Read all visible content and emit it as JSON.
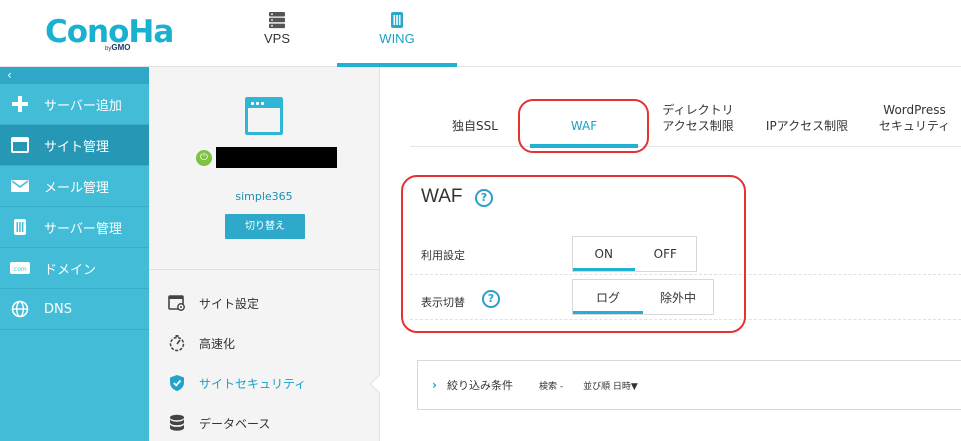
{
  "header": {
    "logo_text": "ConoHa",
    "logo_sub_by": "by",
    "logo_sub_brand": "GMO",
    "tabs": [
      {
        "label": "VPS",
        "active": false,
        "icon": "server-rack-icon"
      },
      {
        "label": "WING",
        "active": true,
        "icon": "wing-server-icon"
      }
    ]
  },
  "leftnav": {
    "collapse_glyph": "‹",
    "items": [
      {
        "label": "サーバー追加",
        "icon": "plus-icon",
        "active": false
      },
      {
        "label": "サイト管理",
        "icon": "window-icon",
        "active": true
      },
      {
        "label": "メール管理",
        "icon": "mail-icon",
        "active": false
      },
      {
        "label": "サーバー管理",
        "icon": "server-icon",
        "active": false
      },
      {
        "label": "ドメイン",
        "icon": "domain-icon",
        "active": false
      },
      {
        "label": "DNS",
        "icon": "globe-icon",
        "active": false
      }
    ]
  },
  "server": {
    "name": "simple365",
    "switch_label": "切り替え",
    "status": "on",
    "sub_items": [
      {
        "label": "サイト設定",
        "icon": "site-settings-icon",
        "active": false
      },
      {
        "label": "高速化",
        "icon": "speed-icon",
        "active": false
      },
      {
        "label": "サイトセキュリティ",
        "icon": "shield-icon",
        "active": true
      },
      {
        "label": "データベース",
        "icon": "database-icon",
        "active": false
      }
    ]
  },
  "security_tabs": [
    {
      "label": "独自SSL",
      "active": false
    },
    {
      "label": "WAF",
      "active": true
    },
    {
      "label": "ディレクトリ\nアクセス制限",
      "active": false
    },
    {
      "label": "IPアクセス制限",
      "active": false
    },
    {
      "label": "WordPress\nセキュリティ",
      "active": false
    }
  ],
  "waf": {
    "title": "WAF",
    "help_glyph": "?",
    "usage_label": "利用設定",
    "usage_options": [
      "ON",
      "OFF"
    ],
    "usage_selected": "ON",
    "display_label": "表示切替",
    "display_options": [
      "ログ",
      "除外中"
    ],
    "display_selected": "ログ"
  },
  "filter": {
    "title": "絞り込み条件",
    "search_text": "検索 -",
    "sort_text": "並び順 日時▼"
  },
  "colors": {
    "brand": "#1ab1cf",
    "nav_bg": "#43bcd8",
    "nav_active": "#2797b6",
    "accent": "#23b0d3",
    "annotation": "#e53232",
    "status_green": "#7dc241"
  }
}
